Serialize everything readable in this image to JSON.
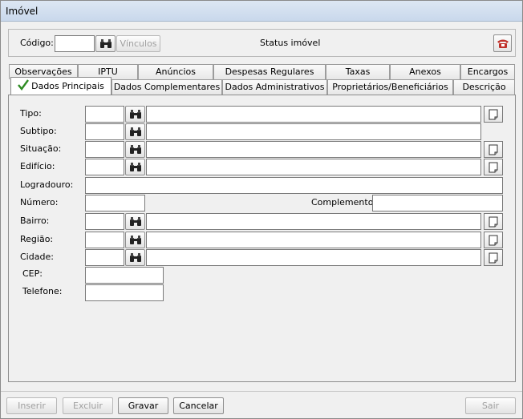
{
  "window": {
    "title": "Imóvel"
  },
  "header": {
    "codigo_label": "Código:",
    "codigo_value": "",
    "vinculos_label": "Vínculos",
    "status_label": "Status imóvel"
  },
  "tabs_row1": [
    "Observações",
    "IPTU",
    "Anúncios",
    "Despesas Regulares",
    "Taxas",
    "Anexos",
    "Encargos"
  ],
  "tabs_row2": [
    "Dados Principais",
    "Dados Complementares",
    "Dados Administrativos",
    "Proprietários/Beneficiários",
    "Descrição"
  ],
  "form": {
    "tipo": "Tipo:",
    "subtipo": "Subtipo:",
    "situacao": "Situação:",
    "edificio": "Edifício:",
    "logradouro": "Logradouro:",
    "numero": "Número:",
    "complemento": "Complemento:",
    "bairro": "Bairro:",
    "regiao": "Região:",
    "cidade": "Cidade:",
    "cep": "CEP:",
    "telefone": "Telefone:"
  },
  "buttons": {
    "inserir": "Inserir",
    "excluir": "Excluir",
    "gravar": "Gravar",
    "cancelar": "Cancelar",
    "sair": "Sair"
  },
  "colors": {
    "check": "#2e8b22",
    "phone": "#c0302a"
  }
}
